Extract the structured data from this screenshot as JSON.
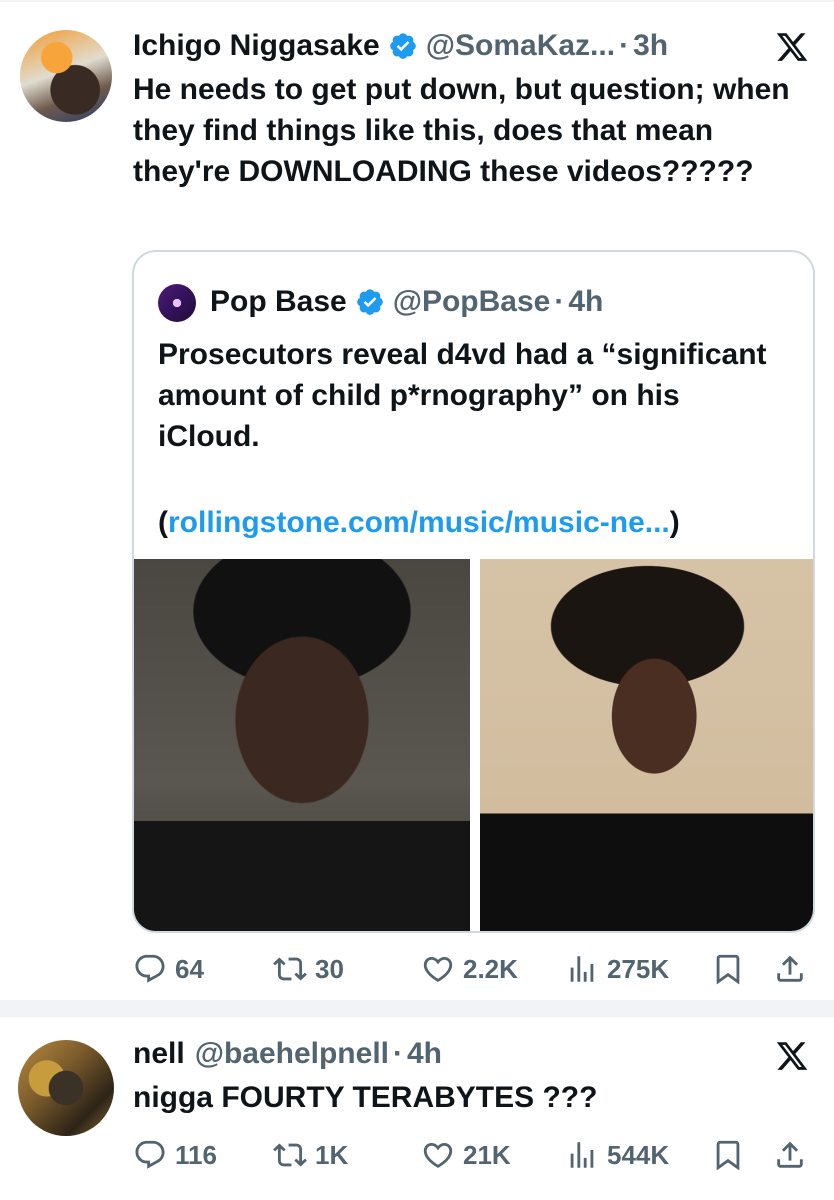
{
  "tweets": [
    {
      "author": {
        "name": "Ichigo Niggasake",
        "handle": "@SomaKaz...",
        "time": "3h",
        "verified": true
      },
      "text": "He needs to get put down, but question; when they find things like this, does that mean they're DOWNLOADING these videos?????",
      "quote": {
        "author": {
          "name": "Pop Base",
          "handle": "@PopBase",
          "time": "4h",
          "verified": true
        },
        "text": "Prosecutors reveal d4vd had a “significant amount of child p*rnography” on his iCloud.",
        "link_open": "(",
        "link": "rollingstone.com/music/music-ne...",
        "link_close": ")"
      },
      "stats": {
        "replies": "64",
        "reposts": "30",
        "likes": "2.2K",
        "views": "275K"
      }
    },
    {
      "author": {
        "name": "nell",
        "handle": "@baehelpnell",
        "time": "4h",
        "verified": false
      },
      "text": "nigga FOURTY TERABYTES ???",
      "stats": {
        "replies": "116",
        "reposts": "1K",
        "likes": "21K",
        "views": "544K"
      }
    }
  ],
  "separator": "·",
  "colors": {
    "text": "#0f1419",
    "secondary": "#536471",
    "verified": "#1d9bf0",
    "link": "#1d9bf0",
    "border": "#cfd9de"
  }
}
